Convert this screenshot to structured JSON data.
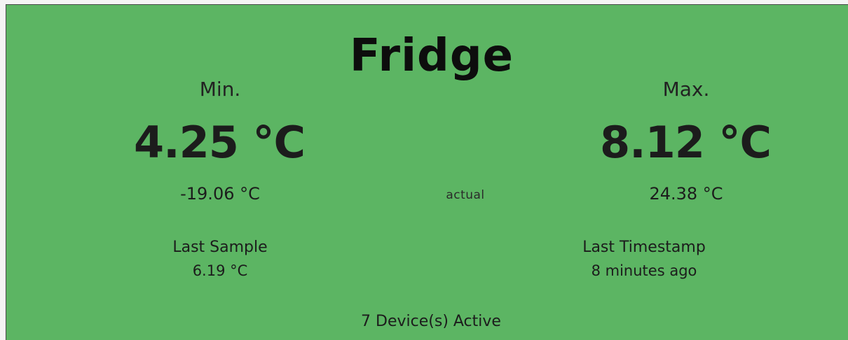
{
  "panel": {
    "title": "Fridge",
    "background_color": "#5cb563",
    "min": {
      "label": "Min.",
      "value": "4.25 °C",
      "secondary": "-19.06 °C"
    },
    "max": {
      "label": "Max.",
      "value": "8.12 °C",
      "secondary": "24.38 °C"
    },
    "actual_label": "actual",
    "last_sample": {
      "label": "Last Sample",
      "value": "6.19 °C"
    },
    "last_timestamp": {
      "label": "Last Timestamp",
      "value": "8 minutes ago"
    },
    "devices_active": "7 Device(s) Active"
  }
}
